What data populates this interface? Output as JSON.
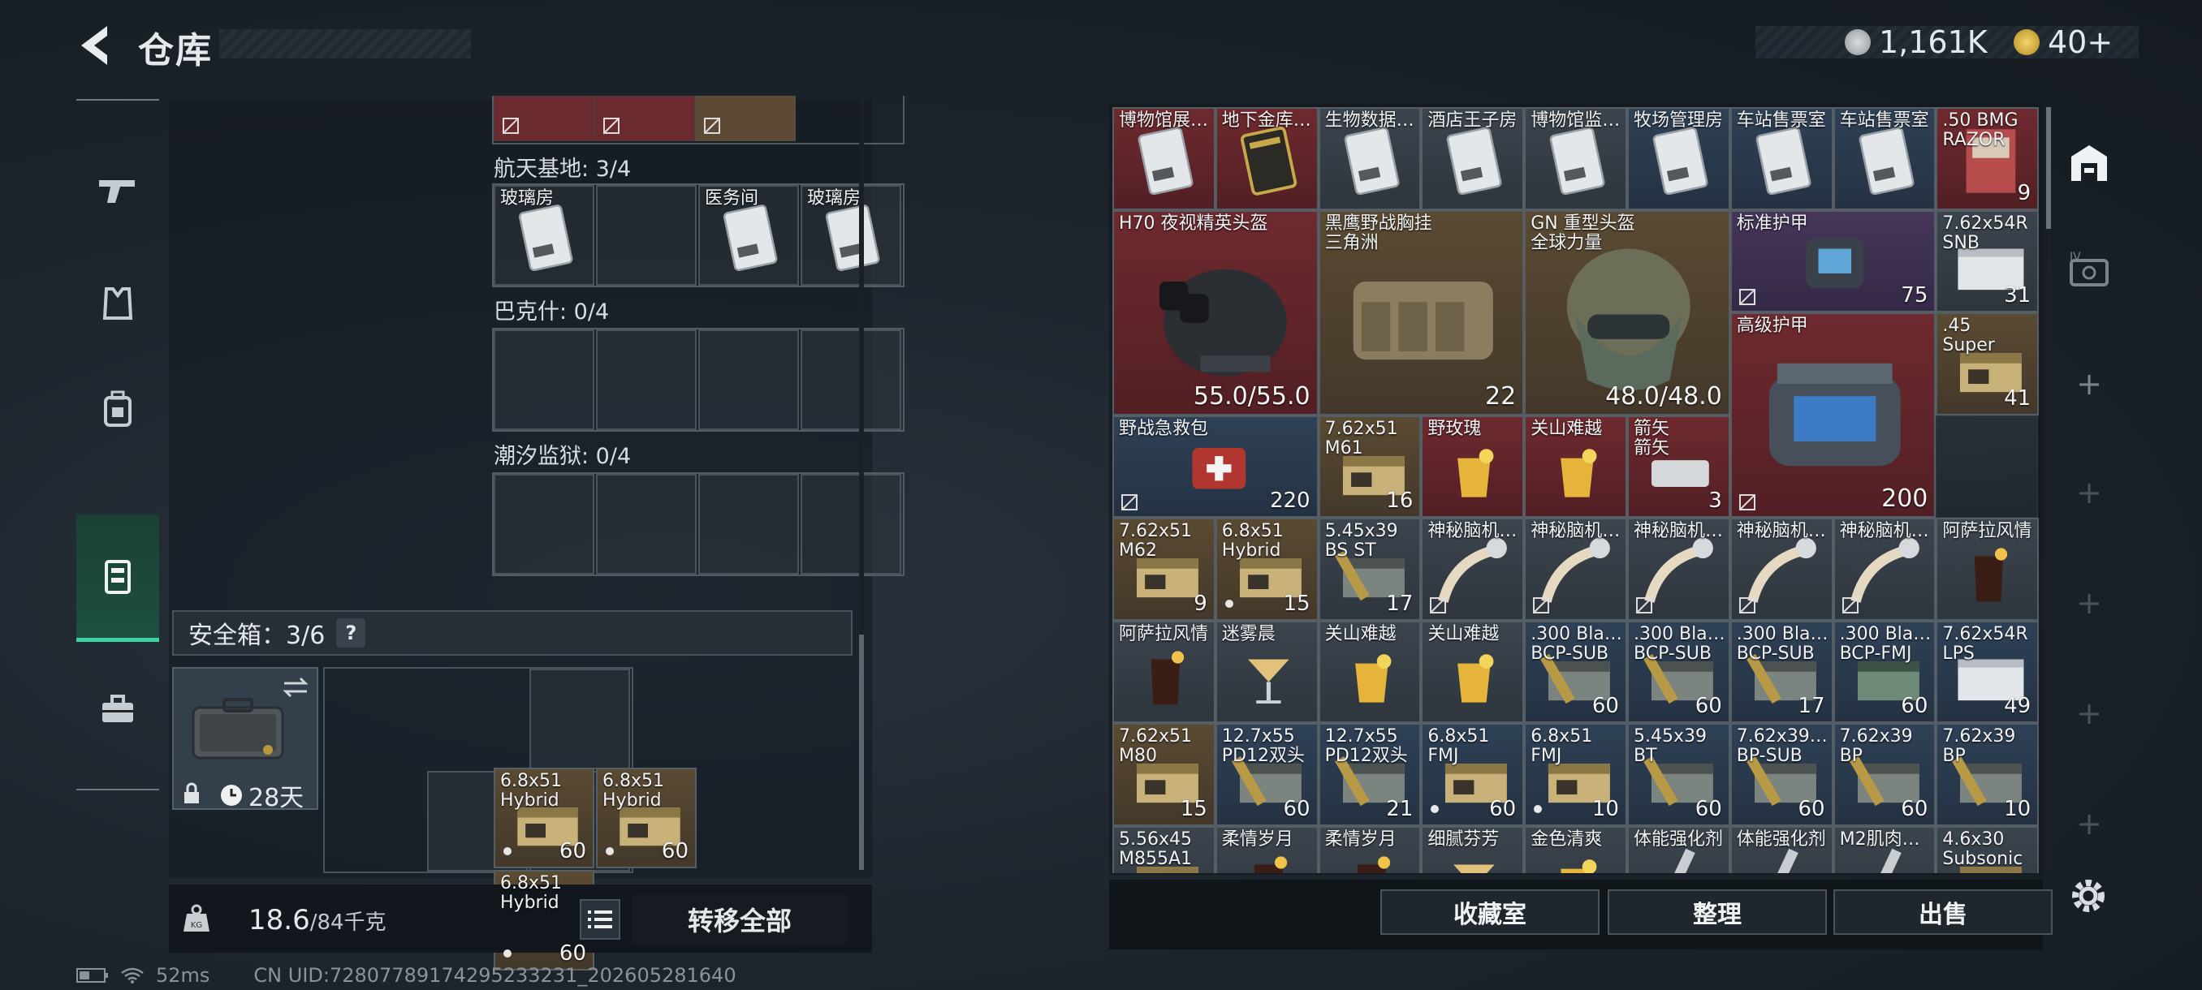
{
  "header": {
    "title": "仓库",
    "currency_1": "1,161K",
    "currency_2": "40+"
  },
  "sidebar": {
    "items": [
      "weapons",
      "armor",
      "backpack",
      "storage",
      "tools"
    ]
  },
  "left": {
    "top_row_partial": true,
    "sec1": {
      "label": "航天基地: 3/4",
      "items": [
        "玻璃房",
        "",
        "医务间",
        "玻璃房"
      ]
    },
    "sec2": {
      "label": "巴克什: 0/4"
    },
    "sec3": {
      "label": "潮汐监狱: 0/4"
    },
    "safe": {
      "label": "安全箱：3/6",
      "help": "?",
      "days": "28天",
      "items": [
        {
          "name": "6.8x51\nHybrid",
          "count": "60"
        },
        {
          "name": "6.8x51\nHybrid",
          "count": "60"
        },
        {
          "name": "6.8x51\nHybrid",
          "count": "60"
        }
      ]
    },
    "weight": {
      "value": "18.6",
      "max": "/84千克"
    },
    "transfer_label": "转移全部"
  },
  "stash": {
    "items": [
      {
        "r": 0,
        "c": 0,
        "w": 1,
        "h": 1,
        "bg": "red",
        "name": "博物馆展…",
        "kind": "card"
      },
      {
        "r": 0,
        "c": 1,
        "w": 1,
        "h": 1,
        "bg": "red",
        "name": "地下金库…",
        "kind": "gold"
      },
      {
        "r": 0,
        "c": 2,
        "w": 1,
        "h": 1,
        "bg": "gray",
        "name": "生物数据…",
        "kind": "card"
      },
      {
        "r": 0,
        "c": 3,
        "w": 1,
        "h": 1,
        "bg": "gray",
        "name": "酒店王子房",
        "kind": "card"
      },
      {
        "r": 0,
        "c": 4,
        "w": 1,
        "h": 1,
        "bg": "gray",
        "name": "博物馆监…",
        "kind": "card"
      },
      {
        "r": 0,
        "c": 5,
        "w": 1,
        "h": 1,
        "bg": "blue",
        "name": "牧场管理房",
        "kind": "card"
      },
      {
        "r": 0,
        "c": 6,
        "w": 1,
        "h": 1,
        "bg": "blue",
        "name": "车站售票室",
        "kind": "card"
      },
      {
        "r": 0,
        "c": 7,
        "w": 1,
        "h": 1,
        "bg": "blue",
        "name": "车站售票室",
        "kind": "card"
      },
      {
        "r": 0,
        "c": 8,
        "w": 1,
        "h": 1,
        "bg": "red",
        "name": ".50 BMG\nRAZOR",
        "kind": "ammo-red",
        "count": "9"
      },
      {
        "r": 1,
        "c": 0,
        "w": 2,
        "h": 2,
        "bg": "red",
        "name": "H70 夜视精英头盔",
        "kind": "helmet",
        "count": "55.0/55.0"
      },
      {
        "r": 1,
        "c": 2,
        "w": 2,
        "h": 2,
        "bg": "gold",
        "name": "黑鹰野战胸挂\n三角洲",
        "kind": "vest",
        "count": "22"
      },
      {
        "r": 1,
        "c": 4,
        "w": 2,
        "h": 2,
        "bg": "gold",
        "name": "GN 重型头盔\n全球力量",
        "kind": "helmet2",
        "count": "48.0/48.0"
      },
      {
        "r": 1,
        "c": 6,
        "w": 2,
        "h": 1,
        "bg": "purple",
        "name": "标准护甲",
        "kind": "armor",
        "count": "75"
      },
      {
        "r": 1,
        "c": 8,
        "w": 1,
        "h": 1,
        "bg": "gray",
        "name": "7.62x54R\nSNB",
        "kind": "ammo-box",
        "count": "31"
      },
      {
        "r": 2,
        "c": 6,
        "w": 2,
        "h": 2,
        "bg": "red",
        "name": "高级护甲",
        "kind": "armor2",
        "count": "200"
      },
      {
        "r": 2,
        "c": 8,
        "w": 1,
        "h": 1,
        "bg": "gold",
        "name": ".45\nSuper",
        "kind": "ammo",
        "count": "41"
      },
      {
        "r": 3,
        "c": 0,
        "w": 2,
        "h": 1,
        "bg": "blue",
        "name": "野战急救包",
        "kind": "medkit",
        "count": "220"
      },
      {
        "r": 3,
        "c": 2,
        "w": 1,
        "h": 1,
        "bg": "gold",
        "name": "7.62x51\nM61",
        "kind": "ammo",
        "count": "16"
      },
      {
        "r": 3,
        "c": 3,
        "w": 1,
        "h": 1,
        "bg": "red",
        "name": "野玫瑰",
        "kind": "drink-y"
      },
      {
        "r": 3,
        "c": 4,
        "w": 1,
        "h": 1,
        "bg": "red",
        "name": "关山难越",
        "kind": "drink-y"
      },
      {
        "r": 3,
        "c": 5,
        "w": 1,
        "h": 1,
        "bg": "red",
        "name": "箭矢\n箭矢",
        "kind": "tin",
        "count": "3"
      },
      {
        "r": 4,
        "c": 0,
        "w": 1,
        "h": 1,
        "bg": "gold",
        "name": "7.62x51\nM62",
        "kind": "ammo",
        "count": "9"
      },
      {
        "r": 4,
        "c": 1,
        "w": 1,
        "h": 1,
        "bg": "gold",
        "name": "6.8x51\nHybrid",
        "kind": "ammo",
        "count": "15",
        "dot": true
      },
      {
        "r": 4,
        "c": 2,
        "w": 1,
        "h": 1,
        "bg": "gray",
        "name": "5.45x39\nBS ST",
        "kind": "ammo-dark",
        "count": "17"
      },
      {
        "r": 4,
        "c": 3,
        "w": 1,
        "h": 1,
        "bg": "gray",
        "name": "神秘脑机…",
        "kind": "tube"
      },
      {
        "r": 4,
        "c": 4,
        "w": 1,
        "h": 1,
        "bg": "gray",
        "name": "神秘脑机…",
        "kind": "tube"
      },
      {
        "r": 4,
        "c": 5,
        "w": 1,
        "h": 1,
        "bg": "gray",
        "name": "神秘脑机…",
        "kind": "tube"
      },
      {
        "r": 4,
        "c": 6,
        "w": 1,
        "h": 1,
        "bg": "gray",
        "name": "神秘脑机…",
        "kind": "tube"
      },
      {
        "r": 4,
        "c": 7,
        "w": 1,
        "h": 1,
        "bg": "gray",
        "name": "神秘脑机…",
        "kind": "tube"
      },
      {
        "r": 4,
        "c": 8,
        "w": 1,
        "h": 1,
        "bg": "gray",
        "name": "阿萨拉风情",
        "kind": "drink-d"
      },
      {
        "r": 5,
        "c": 0,
        "w": 1,
        "h": 1,
        "bg": "gray",
        "name": "阿萨拉风情",
        "kind": "drink-d"
      },
      {
        "r": 5,
        "c": 1,
        "w": 1,
        "h": 1,
        "bg": "gray",
        "name": "迷雾晨",
        "kind": "drink-c"
      },
      {
        "r": 5,
        "c": 2,
        "w": 1,
        "h": 1,
        "bg": "gray",
        "name": "关山难越",
        "kind": "drink-y"
      },
      {
        "r": 5,
        "c": 3,
        "w": 1,
        "h": 1,
        "bg": "gray",
        "name": "关山难越",
        "kind": "drink-y"
      },
      {
        "r": 5,
        "c": 4,
        "w": 1,
        "h": 1,
        "bg": "blue",
        "name": ".300 Bla…\nBCP-SUB",
        "kind": "ammo-dark",
        "count": "60"
      },
      {
        "r": 5,
        "c": 5,
        "w": 1,
        "h": 1,
        "bg": "blue",
        "name": ".300 Bla…\nBCP-SUB",
        "kind": "ammo-dark",
        "count": "60"
      },
      {
        "r": 5,
        "c": 6,
        "w": 1,
        "h": 1,
        "bg": "blue",
        "name": ".300 Bla…\nBCP-SUB",
        "kind": "ammo-dark",
        "count": "17"
      },
      {
        "r": 5,
        "c": 7,
        "w": 1,
        "h": 1,
        "bg": "blue",
        "name": ".300 Bla…\nBCP-FMJ",
        "kind": "ammo-green",
        "count": "60"
      },
      {
        "r": 5,
        "c": 8,
        "w": 1,
        "h": 1,
        "bg": "blue",
        "name": "7.62x54R\nLPS",
        "kind": "ammo-box",
        "count": "49"
      },
      {
        "r": 6,
        "c": 0,
        "w": 1,
        "h": 1,
        "bg": "gold",
        "name": "7.62x51\nM80",
        "kind": "ammo",
        "count": "15"
      },
      {
        "r": 6,
        "c": 1,
        "w": 1,
        "h": 1,
        "bg": "blue",
        "name": "12.7x55\nPD12双头",
        "kind": "ammo-dark",
        "count": "60"
      },
      {
        "r": 6,
        "c": 2,
        "w": 1,
        "h": 1,
        "bg": "blue",
        "name": "12.7x55\nPD12双头",
        "kind": "ammo-dark",
        "count": "21"
      },
      {
        "r": 6,
        "c": 3,
        "w": 1,
        "h": 1,
        "bg": "blue",
        "name": "6.8x51\nFMJ",
        "kind": "ammo",
        "count": "60",
        "dot": true
      },
      {
        "r": 6,
        "c": 4,
        "w": 1,
        "h": 1,
        "bg": "blue",
        "name": "6.8x51\nFMJ",
        "kind": "ammo",
        "count": "10",
        "dot": true
      },
      {
        "r": 6,
        "c": 5,
        "w": 1,
        "h": 1,
        "bg": "blue",
        "name": "5.45x39\nBT",
        "kind": "ammo-dark",
        "count": "60"
      },
      {
        "r": 6,
        "c": 6,
        "w": 1,
        "h": 1,
        "bg": "blue",
        "name": "7.62x39…\nBP-SUB",
        "kind": "ammo-dark",
        "count": "60"
      },
      {
        "r": 6,
        "c": 7,
        "w": 1,
        "h": 1,
        "bg": "blue",
        "name": "7.62x39\nBP",
        "kind": "ammo-dark",
        "count": "60"
      },
      {
        "r": 6,
        "c": 8,
        "w": 1,
        "h": 1,
        "bg": "blue",
        "name": "7.62x39\nBP",
        "kind": "ammo-dark",
        "count": "10"
      },
      {
        "r": 7,
        "c": 0,
        "w": 1,
        "h": 1,
        "bg": "gray",
        "name": "5.56x45\nM855A1",
        "kind": "ammo"
      },
      {
        "r": 7,
        "c": 1,
        "w": 1,
        "h": 1,
        "bg": "gray",
        "name": "柔情岁月",
        "kind": "drink-d"
      },
      {
        "r": 7,
        "c": 2,
        "w": 1,
        "h": 1,
        "bg": "gray",
        "name": "柔情岁月",
        "kind": "drink-d"
      },
      {
        "r": 7,
        "c": 3,
        "w": 1,
        "h": 1,
        "bg": "gray",
        "name": "细腻芬芳",
        "kind": "drink-c"
      },
      {
        "r": 7,
        "c": 4,
        "w": 1,
        "h": 1,
        "bg": "gray",
        "name": "金色清爽",
        "kind": "drink-y"
      },
      {
        "r": 7,
        "c": 5,
        "w": 1,
        "h": 1,
        "bg": "gray",
        "name": "体能强化剂",
        "kind": "syringe"
      },
      {
        "r": 7,
        "c": 6,
        "w": 1,
        "h": 1,
        "bg": "gray",
        "name": "体能强化剂",
        "kind": "syringe"
      },
      {
        "r": 7,
        "c": 7,
        "w": 1,
        "h": 1,
        "bg": "gray",
        "name": "M2肌肉…",
        "kind": "syringe"
      },
      {
        "r": 7,
        "c": 8,
        "w": 1,
        "h": 1,
        "bg": "gray",
        "name": "4.6x30\nSubsonic",
        "kind": "ammo"
      }
    ]
  },
  "actions": {
    "collection": "收藏室",
    "sort": "整理",
    "sell": "出售"
  },
  "status": {
    "ping": "52ms",
    "uid": "CN UID:72807789174295233231_202605281640"
  },
  "colors": {
    "accent": "#3fd4a4",
    "red_rarity": "#6e2a2e",
    "gold_rarity": "#5a4a32",
    "blue_rarity": "#2f4156"
  }
}
